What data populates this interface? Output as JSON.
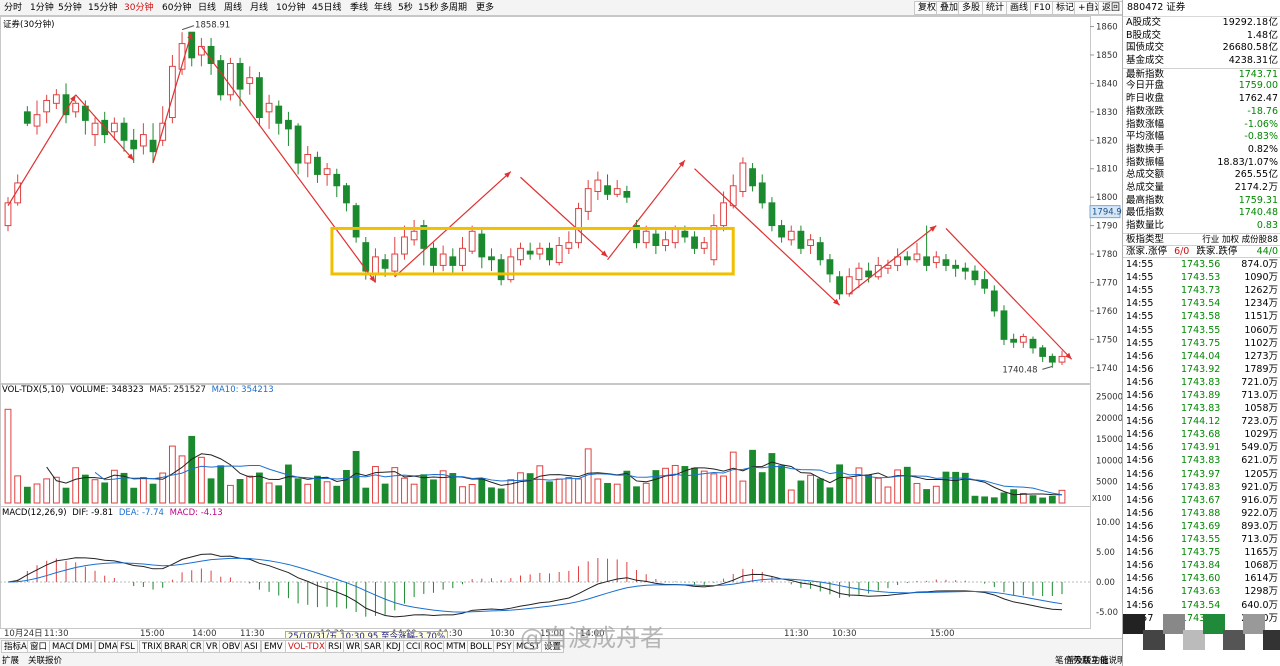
{
  "periods": [
    "分时",
    "1分钟",
    "5分钟",
    "15分钟",
    "30分钟",
    "60分钟",
    "日线",
    "周线",
    "月线",
    "10分钟",
    "45日线",
    "季线",
    "年线",
    "5秒",
    "15秒",
    "多周期",
    "更多"
  ],
  "active_period": "30分钟",
  "top_buttons": [
    "复权",
    "叠加",
    "多股",
    "统计",
    "画线",
    "F10",
    "标记",
    "+自选",
    "返回"
  ],
  "chart": {
    "label": "证券(30分钟)",
    "y_ticks": [
      "1860",
      "1850",
      "1840",
      "1830",
      "1820",
      "1810",
      "1800",
      "1790",
      "1780",
      "1770",
      "1760",
      "1750",
      "1740"
    ],
    "current_price_label": "1794.9",
    "high_label": "1858.91",
    "low_label": "1740.48"
  },
  "chart_data": {
    "type": "candlestick",
    "title": "证券(30分钟)",
    "ylim": [
      1735,
      1863
    ],
    "high": 1858.91,
    "low": 1740.48,
    "candles": [
      [
        1790,
        1798,
        1788,
        1800
      ],
      [
        1798,
        1805,
        1797,
        1808
      ],
      [
        1830,
        1826,
        1825,
        1832
      ],
      [
        1825,
        1829,
        1822,
        1834
      ],
      [
        1830,
        1834,
        1826,
        1836
      ],
      [
        1833,
        1836,
        1831,
        1838
      ],
      [
        1836,
        1829,
        1826,
        1840
      ],
      [
        1830,
        1833,
        1828,
        1834
      ],
      [
        1832,
        1827,
        1822,
        1834
      ],
      [
        1822,
        1826,
        1818,
        1828
      ],
      [
        1827,
        1822,
        1819,
        1830
      ],
      [
        1823,
        1826,
        1820,
        1828
      ],
      [
        1826,
        1820,
        1816,
        1828
      ],
      [
        1820,
        1817,
        1812,
        1824
      ],
      [
        1818,
        1822,
        1815,
        1826
      ],
      [
        1820,
        1816,
        1812,
        1826
      ],
      [
        1820,
        1826,
        1818,
        1832
      ],
      [
        1828,
        1846,
        1826,
        1850
      ],
      [
        1845,
        1854,
        1843,
        1858
      ],
      [
        1858,
        1849,
        1846,
        1858
      ],
      [
        1850,
        1853,
        1846,
        1856
      ],
      [
        1853,
        1847,
        1843,
        1856
      ],
      [
        1848,
        1836,
        1834,
        1850
      ],
      [
        1836,
        1847,
        1834,
        1849
      ],
      [
        1847,
        1838,
        1832,
        1849
      ],
      [
        1840,
        1842,
        1836,
        1846
      ],
      [
        1842,
        1828,
        1825,
        1844
      ],
      [
        1830,
        1833,
        1824,
        1836
      ],
      [
        1832,
        1826,
        1822,
        1834
      ],
      [
        1827,
        1824,
        1818,
        1830
      ],
      [
        1825,
        1812,
        1808,
        1826
      ],
      [
        1812,
        1815,
        1807,
        1818
      ],
      [
        1814,
        1808,
        1805,
        1816
      ],
      [
        1808,
        1810,
        1804,
        1812
      ],
      [
        1808,
        1804,
        1800,
        1810
      ],
      [
        1804,
        1798,
        1795,
        1805
      ],
      [
        1797,
        1786,
        1784,
        1798
      ],
      [
        1784,
        1774,
        1771,
        1786
      ],
      [
        1773,
        1779,
        1770,
        1782
      ],
      [
        1778,
        1775,
        1772,
        1780
      ],
      [
        1774,
        1780,
        1772,
        1786
      ],
      [
        1780,
        1786,
        1778,
        1790
      ],
      [
        1785,
        1788,
        1783,
        1792
      ],
      [
        1790,
        1782,
        1776,
        1792
      ],
      [
        1782,
        1776,
        1773,
        1784
      ],
      [
        1776,
        1780,
        1774,
        1783
      ],
      [
        1779,
        1776,
        1773,
        1782
      ],
      [
        1776,
        1782,
        1774,
        1786
      ],
      [
        1781,
        1788,
        1780,
        1790
      ],
      [
        1787,
        1779,
        1775,
        1789
      ],
      [
        1779,
        1778,
        1774,
        1782
      ],
      [
        1778,
        1771,
        1769,
        1780
      ],
      [
        1771,
        1779,
        1770,
        1782
      ],
      [
        1778,
        1782,
        1776,
        1784
      ],
      [
        1781,
        1780,
        1778,
        1784
      ],
      [
        1780,
        1782,
        1778,
        1784
      ],
      [
        1782,
        1778,
        1776,
        1784
      ],
      [
        1777,
        1783,
        1776,
        1786
      ],
      [
        1782,
        1784,
        1780,
        1788
      ],
      [
        1784,
        1796,
        1782,
        1798
      ],
      [
        1795,
        1803,
        1792,
        1806
      ],
      [
        1802,
        1806,
        1799,
        1809
      ],
      [
        1804,
        1801,
        1799,
        1808
      ],
      [
        1801,
        1803,
        1800,
        1806
      ],
      [
        1802,
        1800,
        1798,
        1804
      ],
      [
        1790,
        1784,
        1782,
        1792
      ],
      [
        1784,
        1788,
        1782,
        1790
      ],
      [
        1787,
        1783,
        1780,
        1789
      ],
      [
        1783,
        1785,
        1781,
        1788
      ],
      [
        1784,
        1789,
        1782,
        1790
      ],
      [
        1788,
        1786,
        1784,
        1790
      ],
      [
        1786,
        1782,
        1780,
        1788
      ],
      [
        1782,
        1784,
        1780,
        1786
      ],
      [
        1778,
        1790,
        1776,
        1794
      ],
      [
        1790,
        1798,
        1788,
        1802
      ],
      [
        1797,
        1804,
        1796,
        1808
      ],
      [
        1802,
        1812,
        1800,
        1814
      ],
      [
        1810,
        1804,
        1802,
        1812
      ],
      [
        1805,
        1798,
        1796,
        1808
      ],
      [
        1798,
        1790,
        1788,
        1800
      ],
      [
        1790,
        1786,
        1784,
        1792
      ],
      [
        1785,
        1788,
        1783,
        1790
      ],
      [
        1788,
        1782,
        1780,
        1790
      ],
      [
        1783,
        1785,
        1780,
        1787
      ],
      [
        1784,
        1778,
        1776,
        1786
      ],
      [
        1778,
        1773,
        1770,
        1780
      ],
      [
        1772,
        1766,
        1764,
        1774
      ],
      [
        1766,
        1772,
        1765,
        1775
      ],
      [
        1771,
        1775,
        1768,
        1777
      ],
      [
        1774,
        1772,
        1770,
        1777
      ],
      [
        1772,
        1776,
        1771,
        1779
      ],
      [
        1775,
        1776,
        1773,
        1778
      ],
      [
        1776,
        1779,
        1774,
        1782
      ],
      [
        1779,
        1778,
        1776,
        1781
      ],
      [
        1778,
        1780,
        1777,
        1784
      ],
      [
        1779,
        1776,
        1774,
        1790
      ],
      [
        1777,
        1779,
        1775,
        1781
      ],
      [
        1778,
        1776,
        1774,
        1780
      ],
      [
        1776,
        1775,
        1772,
        1778
      ],
      [
        1775,
        1774,
        1771,
        1777
      ],
      [
        1774,
        1771,
        1769,
        1776
      ],
      [
        1771,
        1768,
        1766,
        1774
      ],
      [
        1767,
        1760,
        1758,
        1769
      ],
      [
        1760,
        1750,
        1748,
        1762
      ],
      [
        1750,
        1749,
        1747,
        1752
      ],
      [
        1749,
        1751,
        1747,
        1752
      ],
      [
        1750,
        1747,
        1745,
        1751
      ],
      [
        1747,
        1744,
        1742,
        1748
      ],
      [
        1744,
        1742,
        1740,
        1745
      ],
      [
        1742,
        1744,
        1741,
        1746
      ]
    ]
  },
  "volume": {
    "header": [
      "VOL-TDX(5,10)",
      "VOLUME: 348323",
      "MA5: 251527",
      "MA10: 354213"
    ],
    "y_ticks": [
      "25000",
      "20000",
      "15000",
      "10000",
      "5000"
    ],
    "unit": "X100"
  },
  "macd": {
    "header": [
      "MACD(12,26,9)",
      "DIF: -9.81",
      "DEA: -7.74",
      "MACD: -4.13"
    ],
    "y_ticks": [
      "10.00",
      "5.00",
      "0.00",
      "-5.00"
    ]
  },
  "time_axis": {
    "labels": [
      "10月24日",
      "11:30",
      "15:00",
      "14:00",
      "11:30",
      "10:30",
      "14:00",
      "11:30",
      "10:30",
      "15:00",
      "14:00",
      "11:30",
      "10:30",
      "15:00"
    ],
    "tooltip": "25/10/31/五 10:30 95 至今涨幅-3.70%"
  },
  "indicator_tabs": [
    "指标A",
    "窗口",
    "MACD",
    "DMI",
    "DMA",
    "FSL",
    "TRIX",
    "BRAR",
    "CR",
    "VR",
    "OBV",
    "ASI",
    "EMV",
    "VOL-TDX",
    "RSI",
    "WR",
    "SAR",
    "KDJ",
    "CCI",
    "ROC",
    "MTM",
    "BOLL",
    "PSY",
    "MCST",
    "设置"
  ],
  "active_indicator": "VOL-TDX",
  "bottom_row": [
    "扩展",
    "关联报价"
  ],
  "bottom_right": [
    "普及版功能说明",
    "笔",
    "价",
    "势",
    "联",
    "主",
    "值"
  ],
  "watermark": "@自渡成舟者",
  "panel": {
    "code": "880472",
    "name": "证券",
    "stats": [
      {
        "label": "A股成交",
        "value": "19292.18",
        "unit": "亿",
        "cls": ""
      },
      {
        "label": "B股成交",
        "value": "1.48",
        "unit": "亿",
        "cls": ""
      },
      {
        "label": "国债成交",
        "value": "26680.58",
        "unit": "亿",
        "cls": ""
      },
      {
        "label": "基金成交",
        "value": "4238.31",
        "unit": "亿",
        "cls": ""
      },
      {
        "label": "最新指数",
        "value": "1743.71",
        "unit": "",
        "cls": "dn"
      },
      {
        "label": "今日开盘",
        "value": "1759.00",
        "unit": "",
        "cls": "dn"
      },
      {
        "label": "昨日收盘",
        "value": "1762.47",
        "unit": "",
        "cls": ""
      },
      {
        "label": "指数涨跌",
        "value": "-18.76",
        "unit": "",
        "cls": "dn"
      },
      {
        "label": "指数涨幅",
        "value": "-1.06%",
        "unit": "",
        "cls": "dn"
      },
      {
        "label": "平均涨幅",
        "value": "-0.83%",
        "unit": "",
        "cls": "dn"
      },
      {
        "label": "指数换手",
        "value": "0.82%",
        "unit": "",
        "cls": ""
      },
      {
        "label": "指数振幅",
        "value": "18.83/1.07%",
        "unit": "",
        "cls": ""
      },
      {
        "label": "总成交额",
        "value": "265.55",
        "unit": "亿",
        "cls": ""
      },
      {
        "label": "总成交量",
        "value": "2174.2",
        "unit": "万",
        "cls": ""
      },
      {
        "label": "最高指数",
        "value": "1759.31",
        "unit": "",
        "cls": "dn"
      },
      {
        "label": "最低指数",
        "value": "1740.48",
        "unit": "",
        "cls": "dn"
      },
      {
        "label": "指数量比",
        "value": "0.83",
        "unit": "",
        "cls": "dn"
      }
    ],
    "type_row": {
      "label": "板指类型",
      "value": "行业 加权 成份股88"
    },
    "updown": {
      "label1": "涨家.涨停",
      "val1": "6/0",
      "label2": "跌家.跌停",
      "val2": "44/0"
    },
    "ticks": [
      [
        "14:55",
        "1743.56",
        "874.0万"
      ],
      [
        "14:55",
        "1743.53",
        "1090万"
      ],
      [
        "14:55",
        "1743.73",
        "1262万"
      ],
      [
        "14:55",
        "1743.54",
        "1234万"
      ],
      [
        "14:55",
        "1743.58",
        "1151万"
      ],
      [
        "14:55",
        "1743.55",
        "1060万"
      ],
      [
        "14:55",
        "1743.75",
        "1102万"
      ],
      [
        "14:56",
        "1744.04",
        "1273万"
      ],
      [
        "14:56",
        "1743.92",
        "1789万"
      ],
      [
        "14:56",
        "1743.83",
        "721.0万"
      ],
      [
        "14:56",
        "1743.89",
        "713.0万"
      ],
      [
        "14:56",
        "1743.83",
        "1058万"
      ],
      [
        "14:56",
        "1744.12",
        "723.0万"
      ],
      [
        "14:56",
        "1743.68",
        "1029万"
      ],
      [
        "14:56",
        "1743.91",
        "549.0万"
      ],
      [
        "14:56",
        "1743.83",
        "621.0万"
      ],
      [
        "14:56",
        "1743.97",
        "1205万"
      ],
      [
        "14:56",
        "1743.83",
        "921.0万"
      ],
      [
        "14:56",
        "1743.67",
        "916.0万"
      ],
      [
        "14:56",
        "1743.88",
        "922.0万"
      ],
      [
        "14:56",
        "1743.69",
        "893.0万"
      ],
      [
        "14:56",
        "1743.55",
        "713.0万"
      ],
      [
        "14:56",
        "1743.75",
        "1165万"
      ],
      [
        "14:56",
        "1743.84",
        "1068万"
      ],
      [
        "14:56",
        "1743.60",
        "1614万"
      ],
      [
        "14:56",
        "1743.63",
        "1298万"
      ],
      [
        "14:56",
        "1743.54",
        "640.0万"
      ],
      [
        "14:57",
        "1743.68",
        "290.0万"
      ]
    ]
  }
}
